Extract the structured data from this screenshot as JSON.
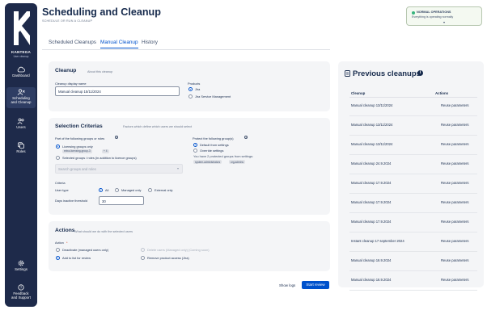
{
  "app": {
    "brand": "KANTEGA",
    "brand_sub": "User cleanup"
  },
  "nav": {
    "items": [
      {
        "label": "Dashboard",
        "icon": "cloud-icon"
      },
      {
        "label": "Scheduling and Cleanup",
        "icon": "user-clean-icon",
        "active": true
      },
      {
        "label": "Users",
        "icon": "users-icon"
      },
      {
        "label": "Roles",
        "icon": "roles-icon"
      },
      {
        "label": "Settings",
        "icon": "gear-icon"
      },
      {
        "label": "Feedback and Support",
        "icon": "feedback-icon"
      }
    ]
  },
  "page": {
    "title": "Scheduling and Cleanup",
    "subtitle": "SCHEDULE OR RUN A CLEANUP"
  },
  "status": {
    "title": "NORMAL OPERATIONS",
    "subtitle": "Everything is operating normally",
    "color": "#36b37e"
  },
  "tabs": [
    "Scheduled Cleanups",
    "Manual Cleanup",
    "History"
  ],
  "cleanup": {
    "heading": "Cleanup",
    "desc": "About this cleanup",
    "name_label": "Cleanup display name",
    "name_value": "Manual cleanup 15/11/2024",
    "products_label": "Products",
    "products": [
      "Jira",
      "Jira Service Management"
    ]
  },
  "criteria": {
    "heading": "Selection Criterias",
    "desc": "Factors which define which users we should select",
    "part_label": "Part of the following groups or roles",
    "opt_licensing": "Licensing groups only",
    "licensing_group": "extra-licensing-group-3",
    "licensing_more": "+ 4",
    "opt_selected": "Selected groups / roles (in addition to licence groups)",
    "search_placeholder": "Search groups and roles",
    "protect_label": "Protect the following group(s)",
    "opt_default": "Default from settings",
    "opt_override": "Override settings",
    "protected_note": "You have 2 protected groups from settings:",
    "protected_groups": [
      "system-administrators",
      "org-admins"
    ],
    "criteria_label": "Criteria",
    "user_type_label": "User type",
    "user_types": [
      "All",
      "Managed only",
      "External only"
    ],
    "days_label": "Days inactive threshold",
    "days_value": "30"
  },
  "actions": {
    "heading": "Actions",
    "desc": "What should we do with the selected users",
    "action_label": "Action",
    "required": "*",
    "opt_deactivate": "Deactivate (managed users only)",
    "opt_delete": "Delete users (Managed only) (Coming soon)",
    "opt_review": "Add to list for review",
    "opt_remove": "Remove product access (Jira)"
  },
  "footer": {
    "show_logs": "Show logs",
    "start_review": "Start review"
  },
  "previous": {
    "heading": "Previous cleanups",
    "col_cleanup": "Cleanup",
    "col_actions": "Actions",
    "rows": [
      {
        "name": "Manual cleanup 13/11/2024",
        "action": "Reuse parameters"
      },
      {
        "name": "Manual cleanup 13/11/2024",
        "action": "Reuse parameters"
      },
      {
        "name": "Manual cleanup 13/11/2024",
        "action": "Reuse parameters"
      },
      {
        "name": "Manual cleanup 24.9.2024",
        "action": "Reuse parameters"
      },
      {
        "name": "Manual cleanup 17.9.2024",
        "action": "Reuse parameters"
      },
      {
        "name": "Manual cleanup 17.9.2024",
        "action": "Reuse parameters"
      },
      {
        "name": "Manual cleanup 17.9.2024",
        "action": "Reuse parameters"
      },
      {
        "name": "Instant cleanup 17 september 2024",
        "action": "Reuse parameters"
      },
      {
        "name": "Manual cleanup 16.9.2024",
        "action": "Reuse parameters"
      },
      {
        "name": "Manual cleanup 16.9.2024",
        "action": "Reuse parameters"
      }
    ]
  },
  "colors": {
    "sidebar": "#1e2a4a",
    "primary": "#0052cc"
  }
}
